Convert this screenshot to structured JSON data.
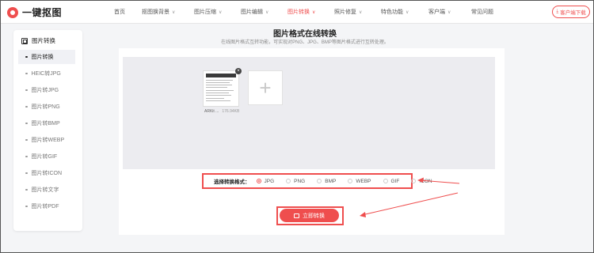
{
  "brand": {
    "name": "一键抠图"
  },
  "nav": {
    "items": [
      {
        "label": "首页",
        "has_menu": false
      },
      {
        "label": "抠图换背景",
        "has_menu": true
      },
      {
        "label": "图片压缩",
        "has_menu": true
      },
      {
        "label": "图片编辑",
        "has_menu": true
      },
      {
        "label": "图片转换",
        "has_menu": true,
        "active": true
      },
      {
        "label": "照片修复",
        "has_menu": true
      },
      {
        "label": "特色功能",
        "has_menu": true
      },
      {
        "label": "客户端",
        "has_menu": true
      },
      {
        "label": "常见问题",
        "has_menu": false
      }
    ],
    "download_label": "客户端下载"
  },
  "sidebar": {
    "title": "图片转换",
    "items": [
      {
        "label": "图片转换",
        "active": true
      },
      {
        "label": "HEIC转JPG"
      },
      {
        "label": "图片转JPG"
      },
      {
        "label": "图片转PNG"
      },
      {
        "label": "图片转BMP"
      },
      {
        "label": "图片转WEBP"
      },
      {
        "label": "图片转GIF"
      },
      {
        "label": "图片转ICON"
      },
      {
        "label": "图片转文字"
      },
      {
        "label": "图片转PDF"
      }
    ]
  },
  "main": {
    "title": "图片格式在线转换",
    "subtitle": "在线图片格式互转功能，可实现对PNG、JPG、BMP等图片格式进行互转处理。",
    "file": {
      "name": "ARKit ...",
      "size": "176.94KB"
    },
    "format_label": "选择转换格式：",
    "formats": [
      {
        "label": "JPG",
        "checked": true
      },
      {
        "label": "PNG"
      },
      {
        "label": "BMP"
      },
      {
        "label": "WEBP"
      },
      {
        "label": "GIF"
      },
      {
        "label": "ICON"
      }
    ],
    "convert_label": "立即转换"
  },
  "colors": {
    "accent": "#ef4e4e",
    "background": "#f4f5f7"
  }
}
